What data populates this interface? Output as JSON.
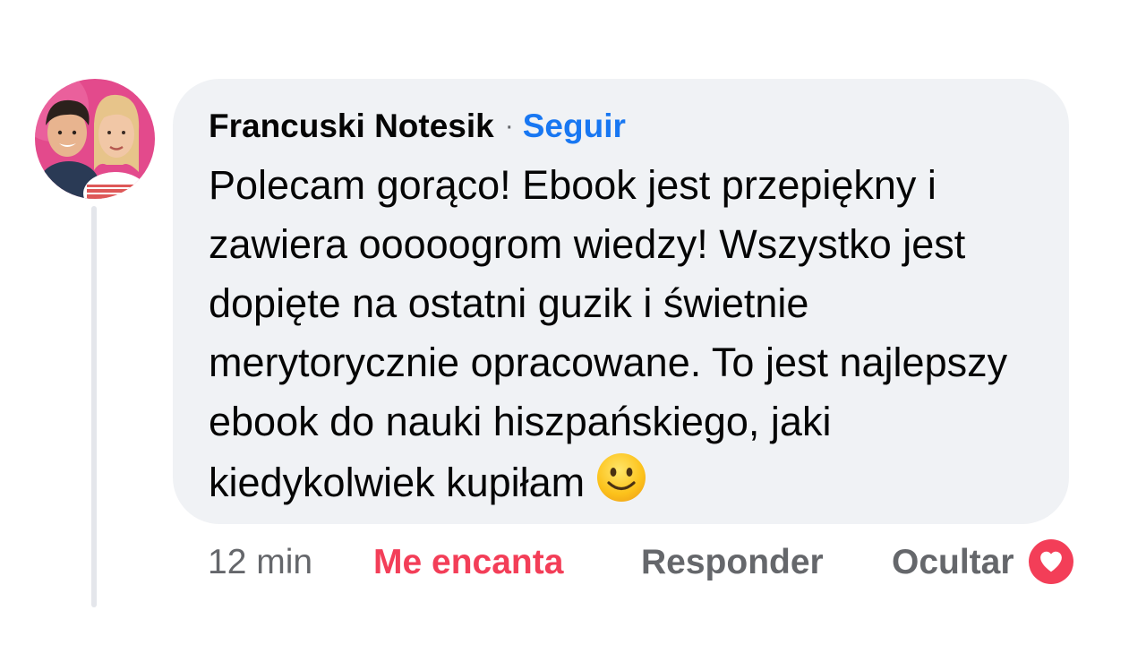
{
  "comment": {
    "author": "Francuski Notesik",
    "separator": "·",
    "follow_label": "Seguir",
    "text": "Polecam gorąco! Ebook jest przepiękny i zawiera ooooogrom wiedzy! Wszystko jest dopięte na ostatni guzik i świetnie merytorycznie opracowane. To jest najlepszy ebook do nauki hiszpańskiego, jaki kiedykolwiek kupiłam",
    "emoji": "slightly-smiling-face-icon"
  },
  "actions": {
    "timestamp": "12 min",
    "love_label": "Me encanta",
    "reply_label": "Responder",
    "hide_label": "Ocultar"
  },
  "reaction": {
    "icon": "heart-icon",
    "color": "#f33e58"
  },
  "colors": {
    "follow_link": "#1877f2",
    "bubble_bg": "#f0f2f5",
    "secondary_text": "#65676b",
    "love_red": "#f33e58"
  }
}
